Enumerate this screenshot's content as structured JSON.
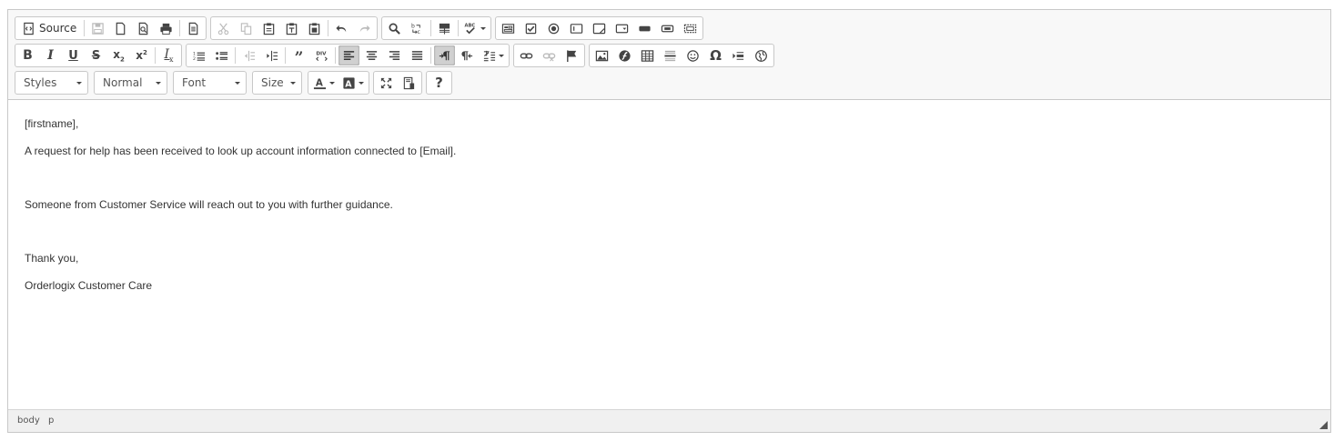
{
  "toolbar": {
    "source_label": "Source",
    "styles_label": "Styles",
    "format_label": "Normal",
    "font_label": "Font",
    "size_label": "Size",
    "help_label": "?",
    "omega_label": "Ω"
  },
  "content": {
    "line1": "[firstname],",
    "line2": "A request for help has been received to look up account information connected to [Email].",
    "line3": "Someone from Customer Service will reach out to you with further guidance.",
    "line4": "Thank you,",
    "line5": "Orderlogix Customer Care"
  },
  "status": {
    "crumb1": "body",
    "crumb2": "p"
  },
  "icons": [
    "source-icon",
    "save-icon",
    "new-page-icon",
    "preview-icon",
    "print-icon",
    "templates-icon",
    "cut-icon",
    "copy-icon",
    "paste-icon",
    "paste-text-icon",
    "paste-word-icon",
    "undo-icon",
    "redo-icon",
    "find-icon",
    "replace-icon",
    "select-all-icon",
    "spellcheck-icon",
    "form-icon",
    "checkbox-icon",
    "radio-icon",
    "textfield-icon",
    "textarea-icon",
    "select-icon",
    "button-icon",
    "imagebutton-icon",
    "hiddenfield-icon",
    "bold-icon",
    "italic-icon",
    "underline-icon",
    "strike-icon",
    "subscript-icon",
    "superscript-icon",
    "remove-format-icon",
    "numbered-list-icon",
    "bulleted-list-icon",
    "outdent-icon",
    "indent-icon",
    "blockquote-icon",
    "creatediv-icon",
    "align-left-icon",
    "align-center-icon",
    "align-right-icon",
    "justify-icon",
    "ltr-icon",
    "rtl-icon",
    "language-icon",
    "link-icon",
    "unlink-icon",
    "anchor-icon",
    "image-icon",
    "flash-icon",
    "table-icon",
    "horizontal-rule-icon",
    "smiley-icon",
    "special-char-icon",
    "pagebreak-icon",
    "iframe-icon",
    "text-color-icon",
    "bg-color-icon",
    "maximize-icon",
    "show-blocks-icon",
    "help-icon"
  ]
}
